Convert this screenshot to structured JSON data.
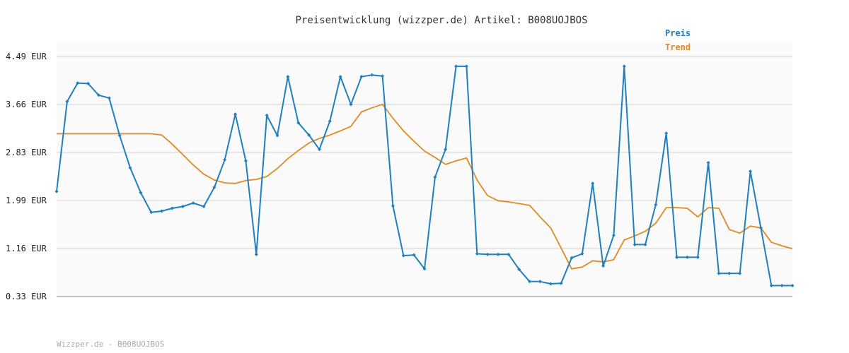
{
  "chart_data": {
    "type": "line",
    "title": "Preisentwicklung (wizzper.de) Artikel: B008UOJBOS",
    "footer": "Wizzper.de - B008UOJBOS",
    "y_ticks": [
      "4.49 EUR",
      "3.66 EUR",
      "2.83 EUR",
      "1.99 EUR",
      "1.16 EUR",
      "0.33 EUR"
    ],
    "ylim": [
      0.33,
      4.49
    ],
    "grid": true,
    "legend_position": "top-right",
    "colors": {
      "preis": "#1f7fbf",
      "trend": "#e08a23",
      "background": "#fafafa"
    },
    "series": [
      {
        "name": "Preis",
        "values": [
          2.15,
          3.71,
          4.03,
          4.02,
          3.82,
          3.77,
          3.12,
          2.56,
          2.13,
          1.79,
          1.81,
          1.86,
          1.89,
          1.95,
          1.89,
          2.22,
          2.7,
          3.49,
          2.68,
          1.06,
          3.47,
          3.12,
          4.14,
          3.34,
          3.13,
          2.88,
          3.37,
          4.14,
          3.66,
          4.14,
          4.17,
          4.15,
          1.9,
          1.04,
          1.05,
          0.81,
          2.4,
          2.88,
          4.32,
          4.32,
          1.07,
          1.06,
          1.06,
          1.06,
          0.8,
          0.59,
          0.59,
          0.55,
          0.56,
          1.0,
          1.07,
          2.29,
          0.86,
          1.39,
          4.32,
          1.23,
          1.23,
          1.92,
          3.16,
          1.01,
          1.01,
          1.01,
          2.65,
          0.73,
          0.73,
          0.73,
          2.5,
          1.52,
          0.52,
          0.52,
          0.52
        ]
      },
      {
        "name": "Trend",
        "values": [
          3.15,
          3.15,
          3.15,
          3.15,
          3.15,
          3.15,
          3.15,
          3.15,
          3.15,
          3.15,
          3.13,
          2.97,
          2.79,
          2.61,
          2.45,
          2.35,
          2.3,
          2.29,
          2.34,
          2.36,
          2.41,
          2.55,
          2.72,
          2.86,
          2.99,
          3.07,
          3.13,
          3.2,
          3.28,
          3.53,
          3.6,
          3.66,
          3.42,
          3.2,
          3.02,
          2.85,
          2.74,
          2.62,
          2.68,
          2.73,
          2.35,
          2.08,
          1.99,
          1.97,
          1.94,
          1.91,
          1.71,
          1.52,
          1.17,
          0.81,
          0.84,
          0.95,
          0.93,
          0.97,
          1.31,
          1.38,
          1.46,
          1.6,
          1.87,
          1.87,
          1.86,
          1.71,
          1.87,
          1.86,
          1.49,
          1.43,
          1.55,
          1.52,
          1.27,
          1.21,
          1.16
        ]
      }
    ]
  }
}
